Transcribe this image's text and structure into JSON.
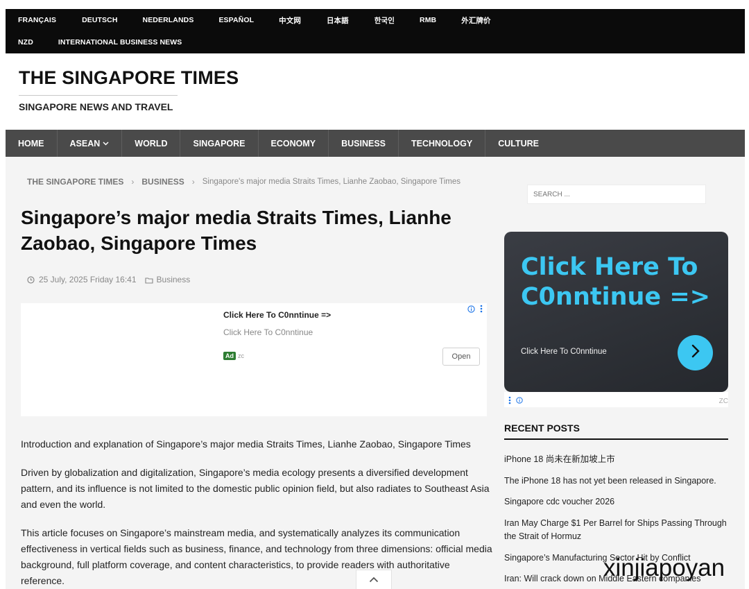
{
  "top_bar": {
    "row1": [
      "FRANÇAIS",
      "DEUTSCH",
      "NEDERLANDS",
      "ESPAÑOL",
      "中文网",
      "日本語",
      "한국인",
      "RMB",
      "外汇牌价"
    ],
    "row2": [
      "NZD",
      "INTERNATIONAL BUSINESS NEWS"
    ]
  },
  "header": {
    "title": "THE SINGAPORE TIMES",
    "tagline": "SINGAPORE NEWS AND TRAVEL"
  },
  "nav": {
    "items": [
      "HOME",
      "ASEAN",
      "WORLD",
      "SINGAPORE",
      "ECONOMY",
      "BUSINESS",
      "TECHNOLOGY",
      "CULTURE"
    ]
  },
  "breadcrumb": {
    "home": "THE SINGAPORE TIMES",
    "section": "BUSINESS",
    "current": "Singapore's major media Straits Times, Lianhe Zaobao, Singapore Times"
  },
  "article": {
    "title": "Singapore’s major media Straits Times, Lianhe Zaobao, Singapore Times",
    "date": "25 July, 2025 Friday 16:41",
    "category": "Business",
    "paragraphs": [
      "Introduction and explanation of Singapore’s major media Straits Times, Lianhe Zaobao, Singapore Times",
      "Driven by globalization and digitalization, Singapore’s media ecology presents a diversified development pattern, and its influence is not limited to the domestic public opinion field, but also radiates to Southeast Asia and even the world.",
      "This article focuses on Singapore’s mainstream media, and systematically analyzes its communication effectiveness in vertical fields such as business, finance, and technology from three dimensions: official media background, full platform coverage, and content characteristics, to provide readers with authoritative reference."
    ]
  },
  "ad": {
    "title": "Click Here To C0nntinue =>",
    "description": "Click Here To C0nntinue",
    "badge": "Ad",
    "advertiser": "zc",
    "open_label": "Open"
  },
  "sidebar": {
    "search_placeholder": "SEARCH ...",
    "promo": {
      "headline": "Click Here To C0nntinue =>",
      "subtext": "Click Here To C0nntinue",
      "footer_mark": "ZC"
    },
    "recent_posts_heading": "RECENT POSTS",
    "recent_posts": [
      "iPhone 18 尚未在新加坡上市",
      "The iPhone 18 has not yet been released in Singapore.",
      "Singapore cdc voucher 2026",
      "Iran May Charge $1 Per Barrel for Ships Passing Through the Strait of Hormuz",
      "Singapore’s Manufacturing Sector Hit by Conflict",
      "Iran: Will crack down on Middle Eastern companies"
    ]
  },
  "watermark": "xinjiapoyan",
  "colors": {
    "top_bar_bg": "#0b0b0b",
    "nav_bg": "#4a4a4a",
    "promo_accent": "#3cc7f2",
    "ad_badge": "#2e7d32"
  }
}
